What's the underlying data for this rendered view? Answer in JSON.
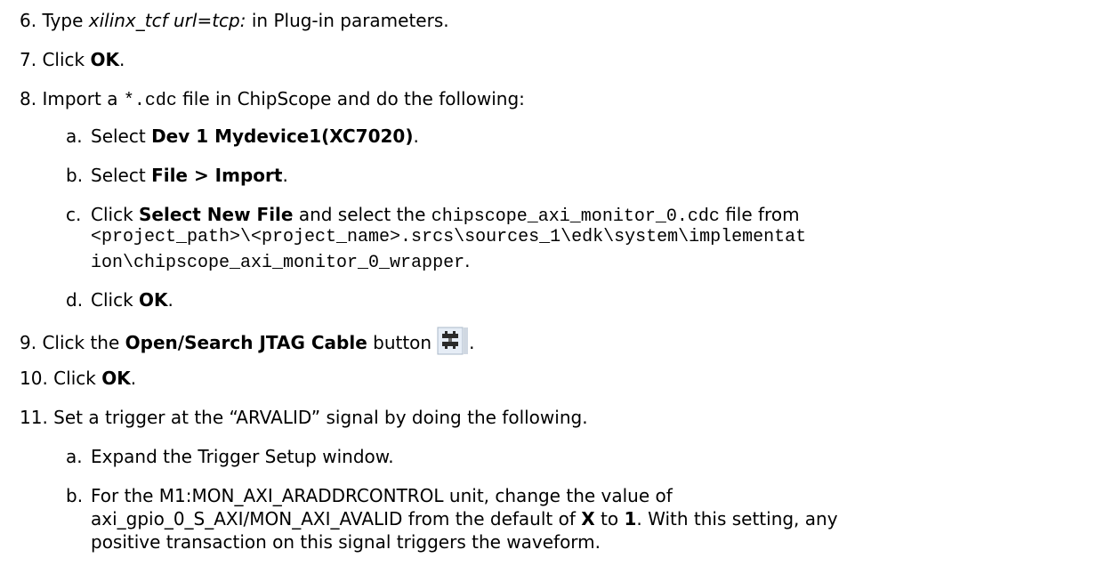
{
  "steps": [
    {
      "num": "6.",
      "p1": "Type ",
      "em": "xilinx_tcf url=tcp:",
      "p2": " in Plug-in parameters."
    },
    {
      "num": "7.",
      "p1": "Click ",
      "b1": "OK",
      "p2": "."
    },
    {
      "num": "8.",
      "p1": "Import a ",
      "code": "*.cdc",
      "p2": " file in ChipScope and do the following:",
      "subs": [
        {
          "letter": "a.",
          "p1": "Select ",
          "b1": "Dev 1 Mydevice1(XC7020)",
          "p2": "."
        },
        {
          "letter": "b.",
          "p1": "Select ",
          "b1": "File > Import",
          "p2": "."
        },
        {
          "letter": "c.",
          "p1": "Click ",
          "b1": "Select New File",
          "p2": " and select the ",
          "code1": "chipscope_axi_monitor_0.cdc",
          "p3": " file from",
          "line2": "<project_path>\\<project_name>.srcs\\sources_1\\edk\\system\\implementat",
          "line3_code": "ion\\chipscope_axi_monitor_0_wrapper",
          "line3_end": "."
        },
        {
          "letter": "d.",
          "p1": "Click ",
          "b1": "OK",
          "p2": "."
        }
      ]
    },
    {
      "num": "9.",
      "p1": "Click the ",
      "b1": "Open/Search JTAG Cable",
      "p2": " button",
      "icon": "jtag-cable-icon",
      "p3": "."
    },
    {
      "num": "10.",
      "p1": "Click ",
      "b1": "OK",
      "p2": "."
    },
    {
      "num": "11.",
      "p1": "Set a trigger at the “ARVALID” signal by doing the following.",
      "subs": [
        {
          "letter": "a.",
          "p1": "Expand the Trigger Setup window."
        },
        {
          "letter": "b.",
          "p1": "For the M1:MON_AXI_ARADDRCONTROL unit, change the value of",
          "line2a": "axi_gpio_0_S_AXI/MON_AXI_AVALID from the default of ",
          "line2b": "X",
          "line2c": " to ",
          "line2d": "1",
          "line2e": ". With this setting, any",
          "line3": "positive transaction on this signal triggers the waveform."
        }
      ]
    }
  ]
}
